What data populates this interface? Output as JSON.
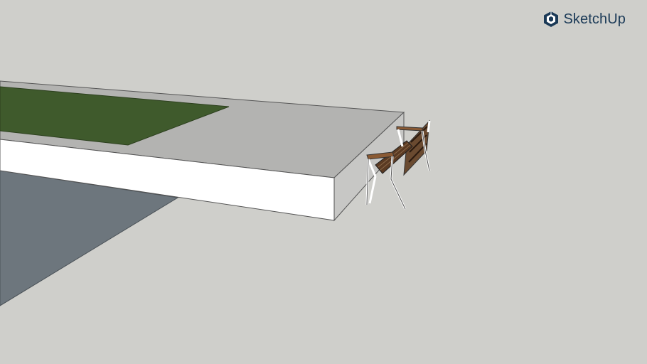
{
  "viewer": {
    "brand": {
      "label": "SketchUp",
      "icon": "sketchup-logo-icon",
      "color": "#1b3a57"
    },
    "scene": {
      "background_color": "#cfcfcb",
      "objects": [
        {
          "name": "raised-planter-platform",
          "top_color": "#b3b3b1",
          "front_color": "#ffffff",
          "side_color": "#c7c7c5"
        },
        {
          "name": "grass-patch",
          "color": "#3f5a2c"
        },
        {
          "name": "ground-shadow-slab",
          "color": "#6d767d"
        },
        {
          "name": "park-bench",
          "seat_color": "#5a3a22",
          "frame_color": "#ffffff"
        }
      ]
    }
  }
}
